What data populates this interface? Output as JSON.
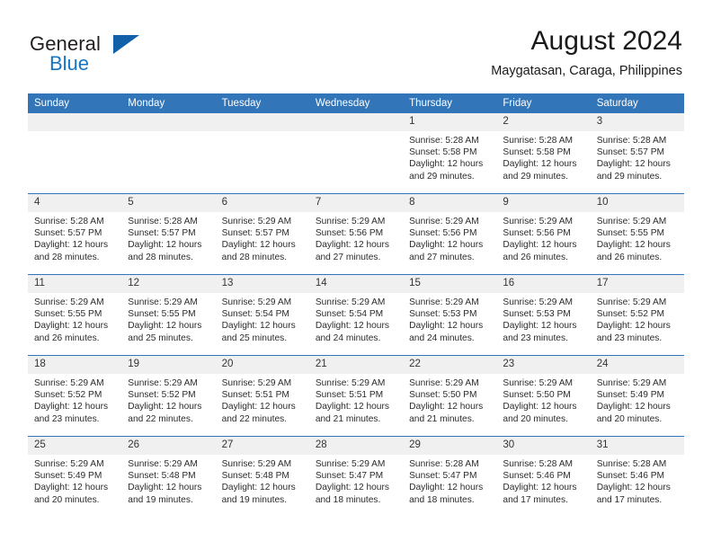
{
  "brand": {
    "word_one": "General",
    "word_two": "Blue",
    "triangle_icon": "logo-triangle"
  },
  "header": {
    "title": "August 2024",
    "subtitle": "Maygatasan, Caraga, Philippines"
  },
  "colors": {
    "header_blue": "#3275b8",
    "brand_blue": "#1675c0",
    "daynum_bg": "#f0f0f0",
    "text": "#2b2b2b"
  },
  "weekdays": [
    "Sunday",
    "Monday",
    "Tuesday",
    "Wednesday",
    "Thursday",
    "Friday",
    "Saturday"
  ],
  "weeks": [
    [
      {
        "day": "",
        "empty": true,
        "lines": []
      },
      {
        "day": "",
        "empty": true,
        "lines": []
      },
      {
        "day": "",
        "empty": true,
        "lines": []
      },
      {
        "day": "",
        "empty": true,
        "lines": []
      },
      {
        "day": "1",
        "lines": [
          "Sunrise: 5:28 AM",
          "Sunset: 5:58 PM",
          "Daylight: 12 hours",
          "and 29 minutes."
        ]
      },
      {
        "day": "2",
        "lines": [
          "Sunrise: 5:28 AM",
          "Sunset: 5:58 PM",
          "Daylight: 12 hours",
          "and 29 minutes."
        ]
      },
      {
        "day": "3",
        "lines": [
          "Sunrise: 5:28 AM",
          "Sunset: 5:57 PM",
          "Daylight: 12 hours",
          "and 29 minutes."
        ]
      }
    ],
    [
      {
        "day": "4",
        "lines": [
          "Sunrise: 5:28 AM",
          "Sunset: 5:57 PM",
          "Daylight: 12 hours",
          "and 28 minutes."
        ]
      },
      {
        "day": "5",
        "lines": [
          "Sunrise: 5:28 AM",
          "Sunset: 5:57 PM",
          "Daylight: 12 hours",
          "and 28 minutes."
        ]
      },
      {
        "day": "6",
        "lines": [
          "Sunrise: 5:29 AM",
          "Sunset: 5:57 PM",
          "Daylight: 12 hours",
          "and 28 minutes."
        ]
      },
      {
        "day": "7",
        "lines": [
          "Sunrise: 5:29 AM",
          "Sunset: 5:56 PM",
          "Daylight: 12 hours",
          "and 27 minutes."
        ]
      },
      {
        "day": "8",
        "lines": [
          "Sunrise: 5:29 AM",
          "Sunset: 5:56 PM",
          "Daylight: 12 hours",
          "and 27 minutes."
        ]
      },
      {
        "day": "9",
        "lines": [
          "Sunrise: 5:29 AM",
          "Sunset: 5:56 PM",
          "Daylight: 12 hours",
          "and 26 minutes."
        ]
      },
      {
        "day": "10",
        "lines": [
          "Sunrise: 5:29 AM",
          "Sunset: 5:55 PM",
          "Daylight: 12 hours",
          "and 26 minutes."
        ]
      }
    ],
    [
      {
        "day": "11",
        "lines": [
          "Sunrise: 5:29 AM",
          "Sunset: 5:55 PM",
          "Daylight: 12 hours",
          "and 26 minutes."
        ]
      },
      {
        "day": "12",
        "lines": [
          "Sunrise: 5:29 AM",
          "Sunset: 5:55 PM",
          "Daylight: 12 hours",
          "and 25 minutes."
        ]
      },
      {
        "day": "13",
        "lines": [
          "Sunrise: 5:29 AM",
          "Sunset: 5:54 PM",
          "Daylight: 12 hours",
          "and 25 minutes."
        ]
      },
      {
        "day": "14",
        "lines": [
          "Sunrise: 5:29 AM",
          "Sunset: 5:54 PM",
          "Daylight: 12 hours",
          "and 24 minutes."
        ]
      },
      {
        "day": "15",
        "lines": [
          "Sunrise: 5:29 AM",
          "Sunset: 5:53 PM",
          "Daylight: 12 hours",
          "and 24 minutes."
        ]
      },
      {
        "day": "16",
        "lines": [
          "Sunrise: 5:29 AM",
          "Sunset: 5:53 PM",
          "Daylight: 12 hours",
          "and 23 minutes."
        ]
      },
      {
        "day": "17",
        "lines": [
          "Sunrise: 5:29 AM",
          "Sunset: 5:52 PM",
          "Daylight: 12 hours",
          "and 23 minutes."
        ]
      }
    ],
    [
      {
        "day": "18",
        "lines": [
          "Sunrise: 5:29 AM",
          "Sunset: 5:52 PM",
          "Daylight: 12 hours",
          "and 23 minutes."
        ]
      },
      {
        "day": "19",
        "lines": [
          "Sunrise: 5:29 AM",
          "Sunset: 5:52 PM",
          "Daylight: 12 hours",
          "and 22 minutes."
        ]
      },
      {
        "day": "20",
        "lines": [
          "Sunrise: 5:29 AM",
          "Sunset: 5:51 PM",
          "Daylight: 12 hours",
          "and 22 minutes."
        ]
      },
      {
        "day": "21",
        "lines": [
          "Sunrise: 5:29 AM",
          "Sunset: 5:51 PM",
          "Daylight: 12 hours",
          "and 21 minutes."
        ]
      },
      {
        "day": "22",
        "lines": [
          "Sunrise: 5:29 AM",
          "Sunset: 5:50 PM",
          "Daylight: 12 hours",
          "and 21 minutes."
        ]
      },
      {
        "day": "23",
        "lines": [
          "Sunrise: 5:29 AM",
          "Sunset: 5:50 PM",
          "Daylight: 12 hours",
          "and 20 minutes."
        ]
      },
      {
        "day": "24",
        "lines": [
          "Sunrise: 5:29 AM",
          "Sunset: 5:49 PM",
          "Daylight: 12 hours",
          "and 20 minutes."
        ]
      }
    ],
    [
      {
        "day": "25",
        "lines": [
          "Sunrise: 5:29 AM",
          "Sunset: 5:49 PM",
          "Daylight: 12 hours",
          "and 20 minutes."
        ]
      },
      {
        "day": "26",
        "lines": [
          "Sunrise: 5:29 AM",
          "Sunset: 5:48 PM",
          "Daylight: 12 hours",
          "and 19 minutes."
        ]
      },
      {
        "day": "27",
        "lines": [
          "Sunrise: 5:29 AM",
          "Sunset: 5:48 PM",
          "Daylight: 12 hours",
          "and 19 minutes."
        ]
      },
      {
        "day": "28",
        "lines": [
          "Sunrise: 5:29 AM",
          "Sunset: 5:47 PM",
          "Daylight: 12 hours",
          "and 18 minutes."
        ]
      },
      {
        "day": "29",
        "lines": [
          "Sunrise: 5:28 AM",
          "Sunset: 5:47 PM",
          "Daylight: 12 hours",
          "and 18 minutes."
        ]
      },
      {
        "day": "30",
        "lines": [
          "Sunrise: 5:28 AM",
          "Sunset: 5:46 PM",
          "Daylight: 12 hours",
          "and 17 minutes."
        ]
      },
      {
        "day": "31",
        "lines": [
          "Sunrise: 5:28 AM",
          "Sunset: 5:46 PM",
          "Daylight: 12 hours",
          "and 17 minutes."
        ]
      }
    ]
  ]
}
